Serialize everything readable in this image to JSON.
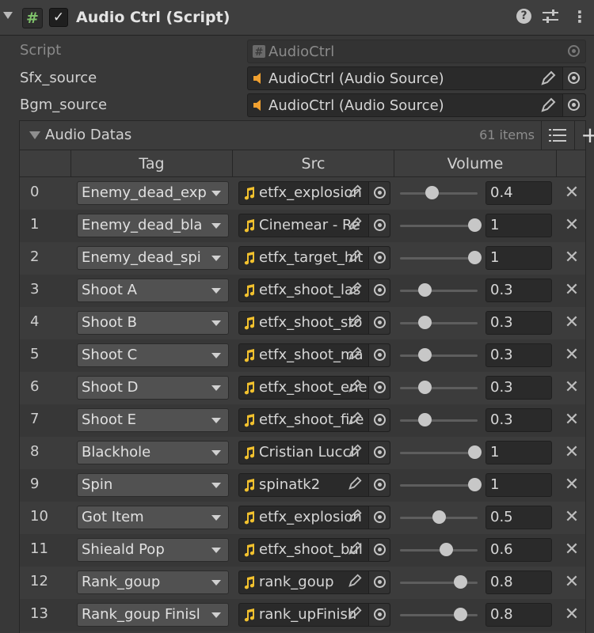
{
  "component": {
    "title": "Audio Ctrl (Script)",
    "enabled_check": "✓",
    "icon_glyph": "#"
  },
  "header_icons": {
    "help": "?",
    "kebab": "⋮",
    "add": "+",
    "remove": "✕"
  },
  "fields": [
    {
      "label": "Script",
      "value": "AudioCtrl",
      "icon": "script-icon",
      "disabled": true
    },
    {
      "label": "Sfx_source",
      "value": "AudioCtrl (Audio Source)",
      "icon": "audio-source-icon"
    },
    {
      "label": "Bgm_source",
      "value": "AudioCtrl (Audio Source)",
      "icon": "audio-source-icon"
    }
  ],
  "list": {
    "title": "Audio Datas",
    "count": "61 items",
    "columns": [
      "Tag",
      "Src",
      "Volume"
    ],
    "rows": [
      {
        "index": "0",
        "tag": "Enemy_dead_exp",
        "src": "etfx_explosion",
        "volume": "0.4",
        "level": 0.4
      },
      {
        "index": "1",
        "tag": "Enemy_dead_bla",
        "src": "Cinemear - Re",
        "volume": "1",
        "level": 1
      },
      {
        "index": "2",
        "tag": "Enemy_dead_spi",
        "src": "etfx_target_hit",
        "volume": "1",
        "level": 1
      },
      {
        "index": "3",
        "tag": "Shoot A",
        "src": "etfx_shoot_las",
        "volume": "0.3",
        "level": 0.3
      },
      {
        "index": "4",
        "tag": "Shoot B",
        "src": "etfx_shoot_sto",
        "volume": "0.3",
        "level": 0.3
      },
      {
        "index": "5",
        "tag": "Shoot C",
        "src": "etfx_shoot_ma",
        "volume": "0.3",
        "level": 0.3
      },
      {
        "index": "6",
        "tag": "Shoot D",
        "src": "etfx_shoot_ene",
        "volume": "0.3",
        "level": 0.3
      },
      {
        "index": "7",
        "tag": "Shoot E",
        "src": "etfx_shoot_fire",
        "volume": "0.3",
        "level": 0.3
      },
      {
        "index": "8",
        "tag": "Blackhole",
        "src": "Cristian Lucch",
        "volume": "1",
        "level": 1
      },
      {
        "index": "9",
        "tag": "Spin",
        "src": "spinatk2",
        "volume": "1",
        "level": 1
      },
      {
        "index": "10",
        "tag": "Got Item",
        "src": "etfx_explosion",
        "volume": "0.5",
        "level": 0.5
      },
      {
        "index": "11",
        "tag": "Shieald Pop",
        "src": "etfx_shoot_bul",
        "volume": "0.6",
        "level": 0.6
      },
      {
        "index": "12",
        "tag": "Rank_goup",
        "src": "rank_goup",
        "volume": "0.8",
        "level": 0.8
      },
      {
        "index": "13",
        "tag": "Rank_goup Finisl",
        "src": "rank_upFinish",
        "volume": "0.8",
        "level": 0.8
      }
    ]
  },
  "colors": {
    "background": "#383838",
    "script_icon_green": "#7fc26b",
    "audio_source_orange": "#f0a030",
    "audio_clip_yellow": "#f2c12e"
  }
}
